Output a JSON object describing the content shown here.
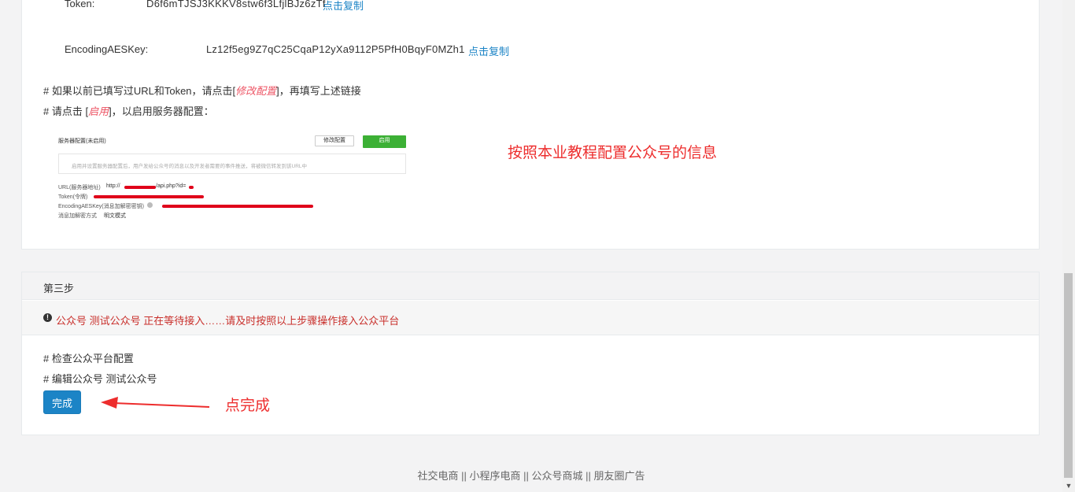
{
  "config": {
    "token_label": "Token:",
    "token_value": "D6f6mTJSJ3KKKV8stw6f3LfjlBJz6zTf",
    "token_copy": "点击复制",
    "aes_label": "EncodingAESKey:",
    "aes_value": "Lz12f5eg9Z7qC25CqaP12yXa9112P5PfH0BqyF0MZh1",
    "aes_copy": "点击复制"
  },
  "instructions": {
    "line1_prefix": "# 如果以前已填写过URL和Token，请点击[",
    "line1_highlight": "修改配置",
    "line1_suffix": "]，再填写上述链接",
    "line2_prefix": "# 请点击 [",
    "line2_highlight": "启用",
    "line2_suffix": "]，以启用服务器配置："
  },
  "embedded_screenshot": {
    "title": "服务器配置(未启用)",
    "modify_button": "修改配置",
    "enable_button": "启用",
    "description": "启用并设置服务器配置后，用户发给公众号的消息以及开发者需要的事件推送，将被微信转发到该URL中",
    "url_label": "URL(服务器地址)",
    "url_value_prefix": "http://",
    "url_value_suffix": "/api.php?id=",
    "token_label": "Token(令牌)",
    "aes_label": "EncodingAESKey(消息加解密密钥)",
    "encrypt_label": "消息加解密方式",
    "encrypt_value": "明文模式"
  },
  "annotation_config": "按照本业教程配置公众号的信息",
  "step3": {
    "title": "第三步",
    "alert_icon": "exclamation-circle-icon",
    "alert_text": "公众号 测试公众号 正在等待接入……请及时按照以上步骤操作接入公众平台",
    "check1": "# 检查公众平台配置",
    "check2": "# 编辑公众号 测试公众号",
    "done_button": "完成",
    "annotation_done": "点完成"
  },
  "footer": {
    "links": [
      "社交电商",
      "小程序电商",
      "公众号商城",
      "朋友圈广告"
    ],
    "separator": "||"
  },
  "colors": {
    "link": "#1c84c6",
    "primary_button": "#1c84c6",
    "alert_red": "#c9302c",
    "annotation_red": "#ed2d2d",
    "enable_green": "#3cb035"
  }
}
